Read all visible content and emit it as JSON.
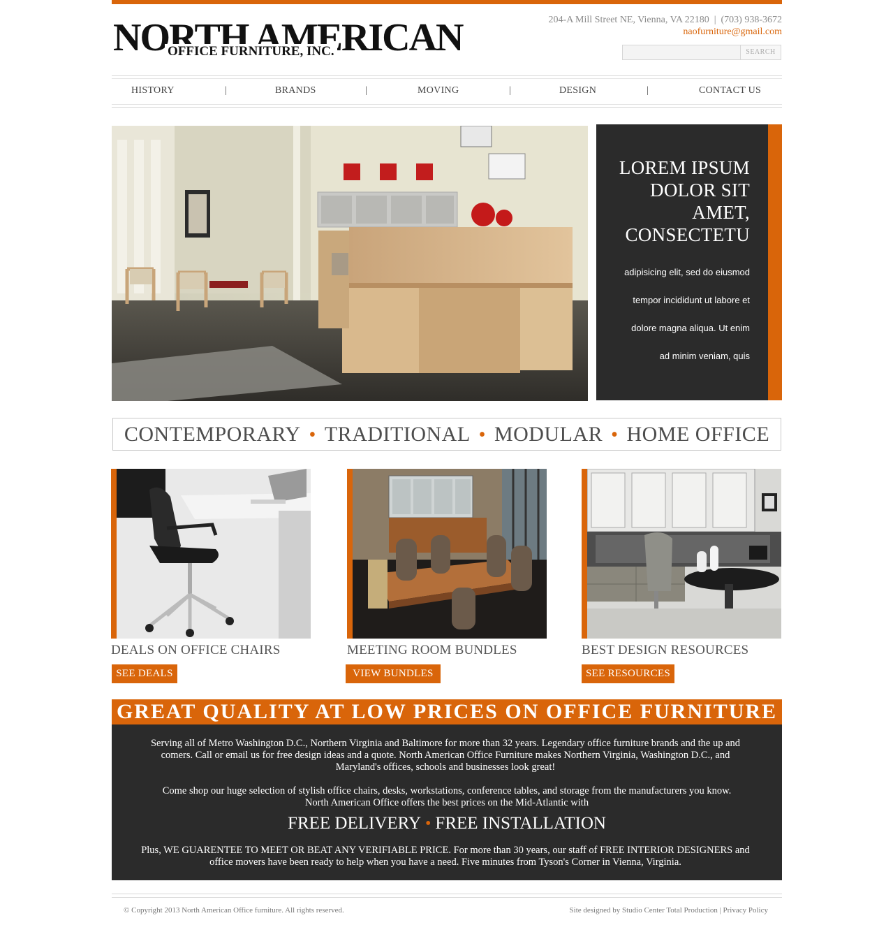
{
  "brand": {
    "logo_line1": "NORTH AMERICAN",
    "logo_line2": "OFFICE FURNITURE, INC."
  },
  "contact": {
    "address_phone": "204-A Mill Street NE, Vienna, VA 22180  |  (703) 938-3672",
    "email": "naofurniture@gmail.com"
  },
  "search": {
    "button_label": "SEARCH",
    "value": ""
  },
  "nav": {
    "items": [
      "HISTORY",
      "BRANDS",
      "MOVING",
      "DESIGN",
      "CONTACT US"
    ],
    "separator": "|"
  },
  "hero": {
    "title": "LOREM IPSUM DOLOR SIT AMET, CONSECTETU",
    "title_lines": [
      "LOREM IPSUM",
      "DOLOR SIT",
      "AMET,",
      "CONSECTETU"
    ],
    "body_lines": [
      "adipisicing elit, sed do eiusmod",
      "tempor incididunt ut labore et",
      "dolore magna aliqua. Ut enim",
      "ad minim veniam, quis"
    ]
  },
  "categories": [
    "CONTEMPORARY",
    "TRADITIONAL",
    "MODULAR",
    "HOME OFFICE"
  ],
  "features": [
    {
      "title": "DEALS ON OFFICE CHAIRS",
      "button": "SEE DEALS"
    },
    {
      "title": "MEETING ROOM BUNDLES",
      "button": "VIEW BUNDLES"
    },
    {
      "title": "BEST DESIGN RESOURCES",
      "button": "SEE RESOURCES"
    }
  ],
  "info": {
    "banner": "GREAT QUALITY AT LOW PRICES ON OFFICE FURNITURE",
    "para1_lines": [
      "Serving all of Metro Washington D.C., Northern Virginia and Baltimore for more than 32 years. Legendary office furniture brands and the up and",
      "comers. Call or email us for free design ideas and a quote. North American Office Furniture makes Northern Virginia, Washington D.C., and",
      "Maryland's offices, schools and businesses look great!"
    ],
    "para2_lines": [
      "Come shop our huge selection of stylish office chairs, desks, workstations, conference tables, and storage from the manufacturers you know.",
      "North American Office offers the best prices on the Mid-Atlantic with"
    ],
    "free_delivery": "FREE DELIVERY",
    "free_installation": "FREE INSTALLATION",
    "para3_lines": [
      "Plus, WE GUARENTEE TO MEET OR BEAT ANY VERIFIABLE PRICE.  For more than 30 years, our staff of FREE INTERIOR DESIGNERS and",
      "office movers have been ready to help when you have a need.  Five minutes from Tyson's Corner in Vienna, Virginia."
    ]
  },
  "footer": {
    "copyright": "© Copyright 2013 North American Office furniture. All rights reserved.",
    "credit": "Site designed by Studio Center Total Production",
    "privacy": "Privacy Policy",
    "divider": "|"
  },
  "colors": {
    "accent": "#d9650a",
    "dark_panel": "#2b2b2b"
  }
}
